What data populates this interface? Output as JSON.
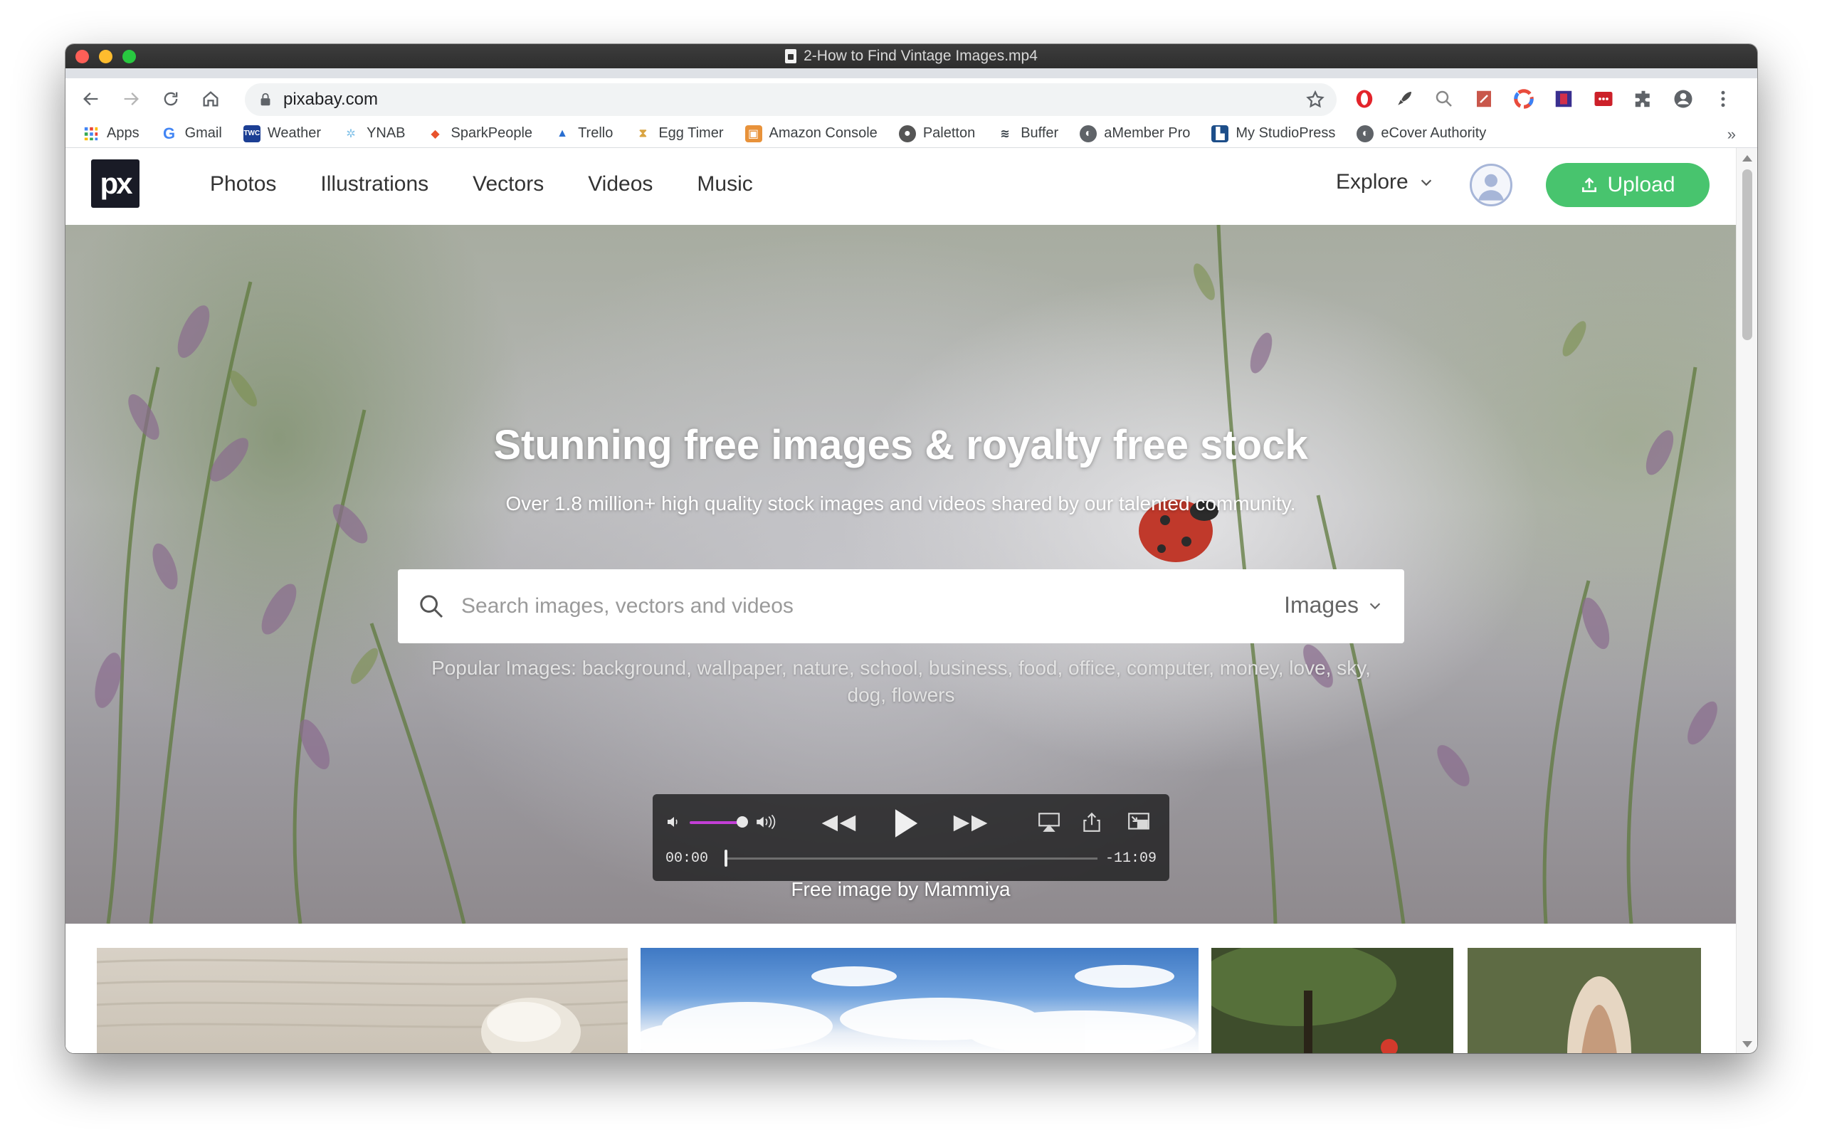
{
  "window": {
    "title": "2-How to Find Vintage Images.mp4"
  },
  "browser": {
    "url": "pixabay.com",
    "bookmarks": [
      {
        "label": "Apps",
        "icon": "apps-grid-icon",
        "color": "#4285f4"
      },
      {
        "label": "Gmail",
        "icon": "google-g-icon",
        "color": "#4285f4"
      },
      {
        "label": "Weather",
        "icon": "weather-channel-icon",
        "color": "#1c3f94"
      },
      {
        "label": "YNAB",
        "icon": "ynab-tree-icon",
        "color": "#85c3e9"
      },
      {
        "label": "SparkPeople",
        "icon": "sparkpeople-icon",
        "color": "#e8532c"
      },
      {
        "label": "Trello",
        "icon": "trello-icon",
        "color": "#2a6fd1"
      },
      {
        "label": "Egg Timer",
        "icon": "egg-timer-icon",
        "color": "#d9a441"
      },
      {
        "label": "Amazon Console",
        "icon": "amazon-box-icon",
        "color": "#e8923a"
      },
      {
        "label": "Paletton",
        "icon": "paletton-icon",
        "color": "#555555"
      },
      {
        "label": "Buffer",
        "icon": "buffer-icon",
        "color": "#323b43"
      },
      {
        "label": "aMember Pro",
        "icon": "globe-icon",
        "color": "#5f6368"
      },
      {
        "label": "My StudioPress",
        "icon": "studiopress-icon",
        "color": "#1d4e89"
      },
      {
        "label": "eCover Authority",
        "icon": "globe-icon",
        "color": "#5f6368"
      }
    ],
    "bookmarks_more": "»"
  },
  "site": {
    "logo": "px",
    "nav": [
      "Photos",
      "Illustrations",
      "Vectors",
      "Videos",
      "Music"
    ],
    "explore_label": "Explore",
    "upload_label": "Upload",
    "accent_color": "#48c46e"
  },
  "hero": {
    "title": "Stunning free images & royalty free stock",
    "subtitle": "Over 1.8 million+ high quality stock images and videos shared by our talented community.",
    "search_placeholder": "Search images, vectors and videos",
    "search_type": "Images",
    "popular_prefix": "Popular Images:",
    "popular_terms": "background, wallpaper, nature, school, business, food, office, computer, money, love, sky, dog, flowers",
    "credit": "Free image by Mammiya"
  },
  "player": {
    "current_time": "00:00",
    "remaining_time": "-11:09",
    "volume_level": 0.6,
    "progress": 0.0
  }
}
